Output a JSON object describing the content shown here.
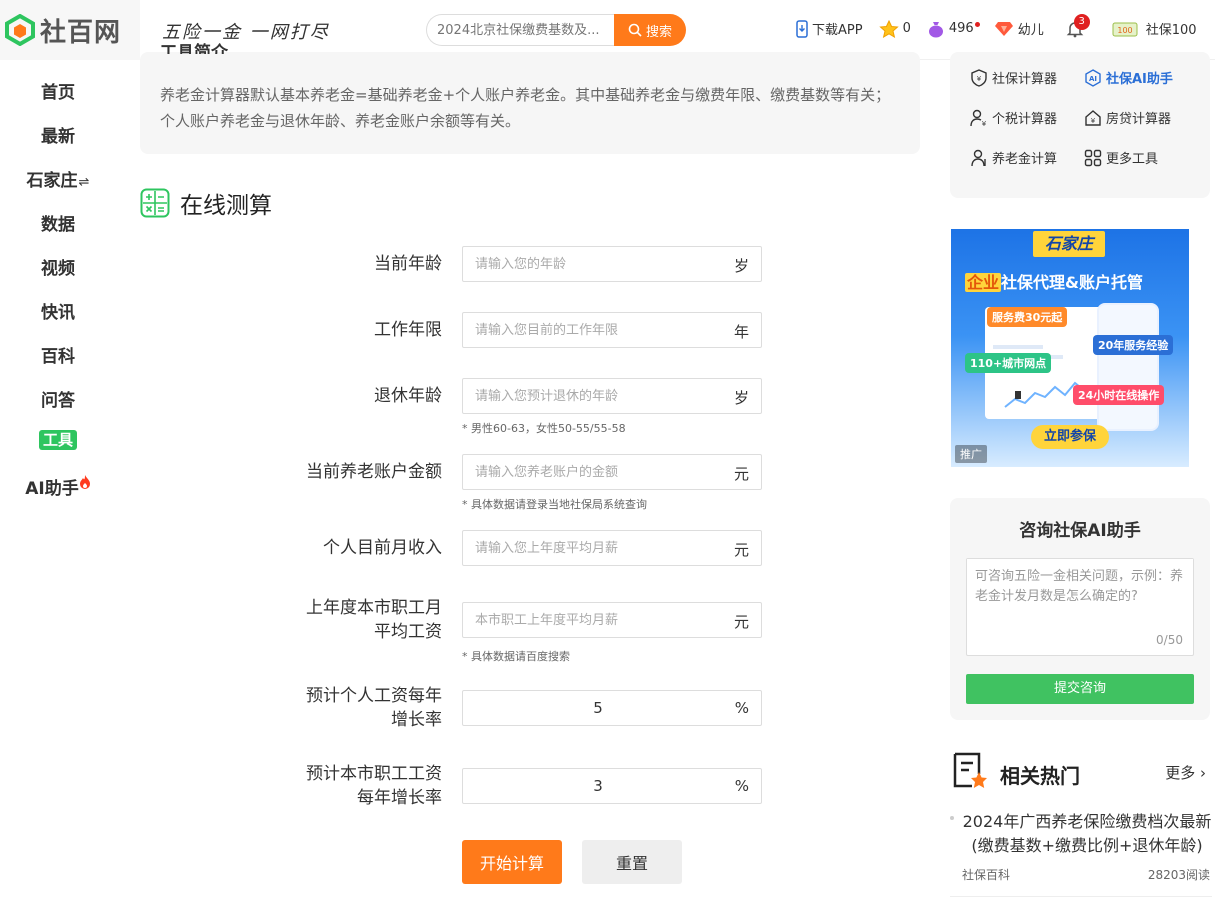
{
  "header": {
    "logo_text": "社百网",
    "slogan": "五险一金  一网打尽",
    "search_placeholder": "2024北京社保缴费基数及...",
    "search_button": "搜索",
    "download_app": "下载APP",
    "stars": "0",
    "coins": "496",
    "diamond_label": "幼儿",
    "bell_count": "3",
    "badge_label": "社保100"
  },
  "nav": {
    "items": [
      "首页",
      "最新",
      "石家庄",
      "数据",
      "视频",
      "快讯",
      "百科",
      "问答",
      "工具",
      "AI助手"
    ],
    "switch_glyph": "⇌",
    "active_index": 8
  },
  "intro": {
    "title": "工具简介",
    "text": "养老金计算器默认基本养老金=基础养老金+个人账户养老金。其中基础养老金与缴费年限、缴费基数等有关；个人账户养老金与退休年龄、养老金账户余额等有关。"
  },
  "form": {
    "section_title": "在线测算",
    "fields": [
      {
        "label": "当前年龄",
        "placeholder": "请输入您的年龄",
        "unit": "岁",
        "hint": "",
        "value": ""
      },
      {
        "label": "工作年限",
        "placeholder": "请输入您目前的工作年限",
        "unit": "年",
        "hint": "",
        "value": ""
      },
      {
        "label": "退休年龄",
        "placeholder": "请输入您预计退休的年龄",
        "unit": "岁",
        "hint": "* 男性60-63，女性50-55/55-58",
        "value": ""
      },
      {
        "label": "当前养老账户金额",
        "placeholder": "请输入您养老账户的金额",
        "unit": "元",
        "hint": "* 具体数据请登录当地社保局系统查询",
        "value": ""
      },
      {
        "label": "个人目前月收入",
        "placeholder": "请输入您上年度平均月薪",
        "unit": "元",
        "hint": "",
        "value": ""
      },
      {
        "label_line1": "上年度本市职工月",
        "label_line2": "平均工资",
        "placeholder": "本市职工上年度平均月薪",
        "unit": "元",
        "hint": "* 具体数据请百度搜索",
        "value": ""
      },
      {
        "label_line1": "预计个人工资每年",
        "label_line2": "增长率",
        "placeholder": "",
        "unit": "%",
        "hint": "",
        "value": "5"
      },
      {
        "label_line1": "预计本市职工工资",
        "label_line2": "每年增长率",
        "placeholder": "",
        "unit": "%",
        "hint": "",
        "value": "3"
      }
    ],
    "calc_button": "开始计算",
    "reset_button": "重置"
  },
  "tools": {
    "items": [
      "社保计算器",
      "社保AI助手",
      "个税计算器",
      "房贷计算器",
      "养老金计算",
      "更多工具"
    ],
    "active_index": 1
  },
  "ad": {
    "city": "石家庄",
    "title_highlight": "企业",
    "title_rest": "社保代理&账户托管",
    "tag1": "服务费30元起",
    "tag2": "20年服务经验",
    "tag3": "110+城市网点",
    "tag4": "24小时在线操作",
    "join": "立即参保",
    "mark": "推广"
  },
  "ai": {
    "title": "咨询社保AI助手",
    "placeholder": "可咨询五险一金相关问题，示例：养老金计发月数是怎么确定的?",
    "count": "0/50",
    "submit": "提交咨询"
  },
  "hot": {
    "title": "相关热门",
    "more": "更多",
    "items": [
      {
        "title": "2024年广西养老保险缴费档次最新(缴费基数+缴费比例+退休年龄)",
        "source": "社保百科",
        "reads": "28203阅读"
      }
    ]
  },
  "colors": {
    "accent_orange": "#ff7a1a",
    "accent_green": "#40c261",
    "link_blue": "#2b6fd6"
  }
}
